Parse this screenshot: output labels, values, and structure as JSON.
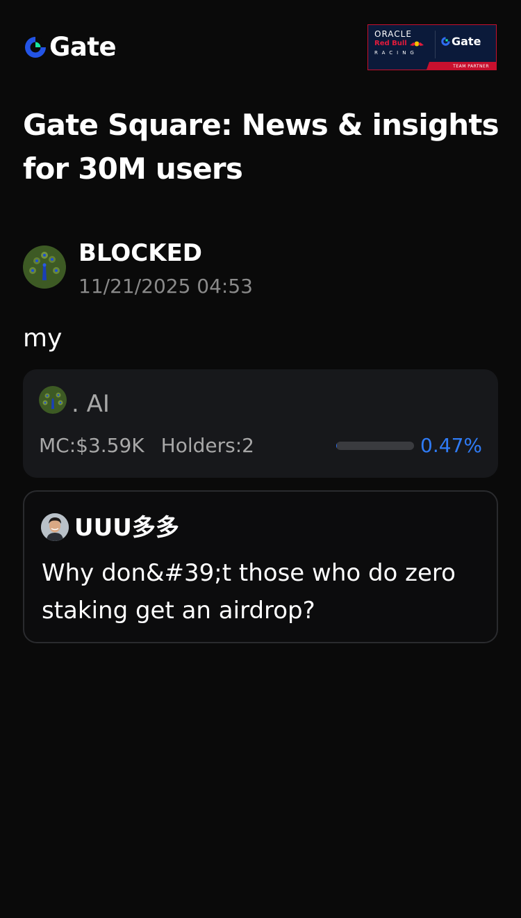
{
  "header": {
    "logo_text": "Gate",
    "partner": {
      "oracle": "ORACLE",
      "redbull": "Red Bull",
      "racing": "RACING",
      "gate_text": "Gate",
      "footer": "TEAM PARTNER"
    }
  },
  "page": {
    "title": "Gate Square: News & insights for 30M users"
  },
  "post": {
    "author": "BLOCKED",
    "time": "11/21/2025 04:53",
    "body": "my"
  },
  "token": {
    "name": ". AI",
    "mc": "MC:$3.59K",
    "holders": "Holders:2",
    "progress_label": "0.47%",
    "progress_percent": 0.47
  },
  "quote": {
    "author": "UUU多多",
    "text": "Why don&#39;t those who do zero staking get an airdrop?"
  },
  "colors": {
    "background": "#0a0a0a",
    "card": "#17181b",
    "accent": "#2f7bf5",
    "muted": "#8a8a8a"
  }
}
